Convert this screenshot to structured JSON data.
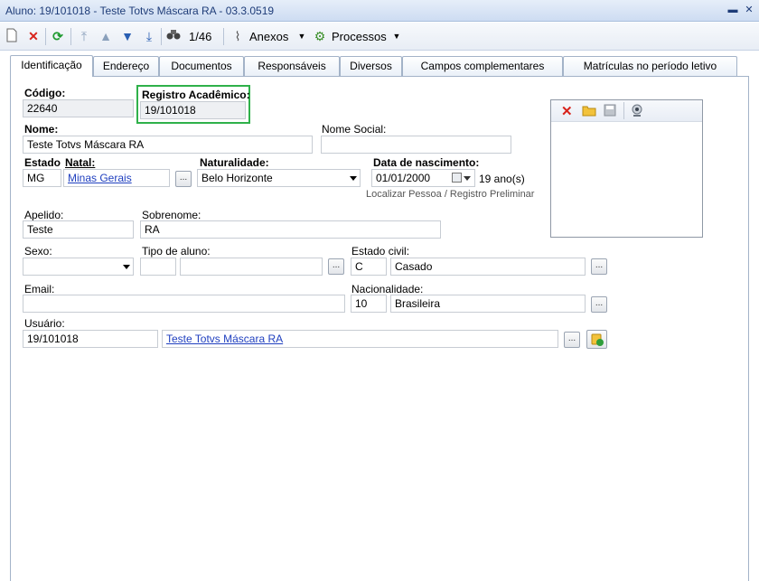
{
  "window": {
    "title": "Aluno: 19/101018 - Teste Totvs Máscara RA - 03.3.0519"
  },
  "toolbar": {
    "record_counter": "1/46",
    "anexos_label": "Anexos",
    "processos_label": "Processos"
  },
  "tabs": [
    {
      "label": "Identificação"
    },
    {
      "label": "Endereço"
    },
    {
      "label": "Documentos"
    },
    {
      "label": "Responsáveis"
    },
    {
      "label": "Diversos"
    },
    {
      "label": "Campos complementares"
    },
    {
      "label": "Matrículas no período letivo"
    }
  ],
  "form": {
    "codigo": {
      "label": "Código:",
      "value": "22640"
    },
    "registro_academico": {
      "label": "Registro Acadêmico:",
      "value": "19/101018"
    },
    "nome": {
      "label": "Nome:",
      "value": "Teste Totvs Máscara RA"
    },
    "nome_social": {
      "label": "Nome Social:",
      "value": ""
    },
    "estado_natal": {
      "label_estado": "Estado",
      "label_natal": "Natal:",
      "uf": "MG",
      "estado": "Minas Gerais"
    },
    "naturalidade": {
      "label": "Naturalidade:",
      "value": "Belo Horizonte"
    },
    "data_nascimento": {
      "label": "Data de nascimento:",
      "value": "01/01/2000",
      "idade": "19 ano(s)"
    },
    "localizar_link": "Localizar Pessoa / Registro Preliminar",
    "apelido": {
      "label": "Apelido:",
      "value": "Teste"
    },
    "sobrenome": {
      "label": "Sobrenome:",
      "value": "RA"
    },
    "sexo": {
      "label": "Sexo:",
      "value": ""
    },
    "tipo_aluno": {
      "label": "Tipo de aluno:",
      "code": "",
      "desc": ""
    },
    "estado_civil": {
      "label": "Estado civil:",
      "code": "C",
      "desc": "Casado"
    },
    "email": {
      "label": "Email:",
      "value": ""
    },
    "nacionalidade": {
      "label": "Nacionalidade:",
      "code": "10",
      "desc": "Brasileira"
    },
    "usuario": {
      "label": "Usuário:",
      "code": "19/101018",
      "name": "Teste Totvs Máscara RA"
    },
    "dots": "..."
  },
  "colors": {
    "highlight_box": "#2fb14a",
    "link": "#1f3fbf",
    "title_text": "#1e3c78"
  }
}
